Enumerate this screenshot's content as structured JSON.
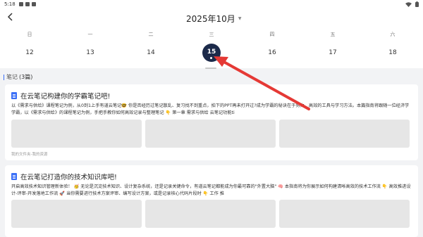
{
  "status_bar": {
    "time": "5:18"
  },
  "calendar": {
    "month_title": "2025年10月",
    "weekdays": [
      "日",
      "一",
      "二",
      "三",
      "四",
      "五",
      "六"
    ],
    "days": [
      "12",
      "13",
      "14",
      "15",
      "16",
      "17",
      "18"
    ],
    "selected_day": "15"
  },
  "notes_section": {
    "label": "笔记",
    "count": "(3篇)"
  },
  "cards": [
    {
      "title": "在云笔记构建你的学霸笔记吧!",
      "body": "以《需求与供给》课程笔记为例，从0到1上手有道云笔记🤓 你是否经历过笔记散乱、复习找不到重点，拍下的PPT再未打开过?成为学霸的秘诀在于努力、高效的工具与学习方法。本篇指南将跟随一位经济学学霸，以《需求与供给》的课程笔记为例，手把手教你如何高效记录与整理笔记 👇 第一章 需求与供给 云笔记功能ti",
      "folder": "我的文件夹-我的资源"
    },
    {
      "title": "在云笔记打造你的技术知识库吧!",
      "body": "开启高效技术知识管理新体验！ 🥳 无论是沉淀技术知识、设计复杂系统，还是记录关键命令，有道云笔记都能成为你最可靠的\"外置大脑\" 🧠 本指南将为你展示如何构建清晰高效的技术工作流 👇 高效推进设计-评审-开发落地工作流 🚀 当你需要进行技术方案评审、编写设计方案，或是记录核心代码片段时 👇 工作 推"
    }
  ],
  "colors": {
    "accent": "#3a6ff7",
    "selected_day_bg": "#1c2a4a",
    "annotation_arrow": "#e53935"
  }
}
